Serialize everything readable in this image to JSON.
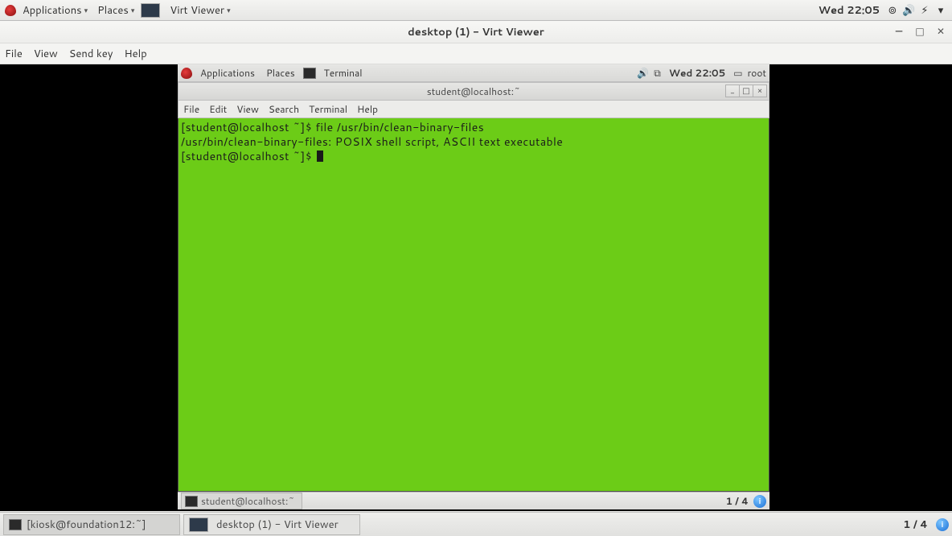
{
  "host": {
    "top": {
      "applications": "Applications",
      "places": "Places",
      "virt_viewer": "Virt Viewer",
      "clock": "Wed 22:05"
    },
    "window": {
      "title": "desktop (1) - Virt Viewer",
      "menu": {
        "file": "File",
        "view": "View",
        "sendkey": "Send key",
        "help": "Help"
      }
    },
    "bottom": {
      "task1": "[kiosk@foundation12:~]",
      "task2": "desktop (1) - Virt Viewer",
      "workspace": "1 / 4"
    }
  },
  "guest": {
    "panel": {
      "applications": "Applications",
      "places": "Places",
      "terminal_app": "Terminal",
      "clock": "Wed 22:05",
      "user": "root"
    },
    "terminal": {
      "title": "student@localhost:~",
      "menu": {
        "file": "File",
        "edit": "Edit",
        "view": "View",
        "search": "Search",
        "terminal": "Terminal",
        "help": "Help"
      },
      "lines": {
        "l1": "[student@localhost ~]$ file /usr/bin/clean-binary-files",
        "l2": "/usr/bin/clean-binary-files: POSIX shell script, ASCII text executable",
        "l3": "[student@localhost ~]$ "
      }
    },
    "bottom": {
      "task": "student@localhost:~",
      "workspace": "1 / 4"
    }
  }
}
